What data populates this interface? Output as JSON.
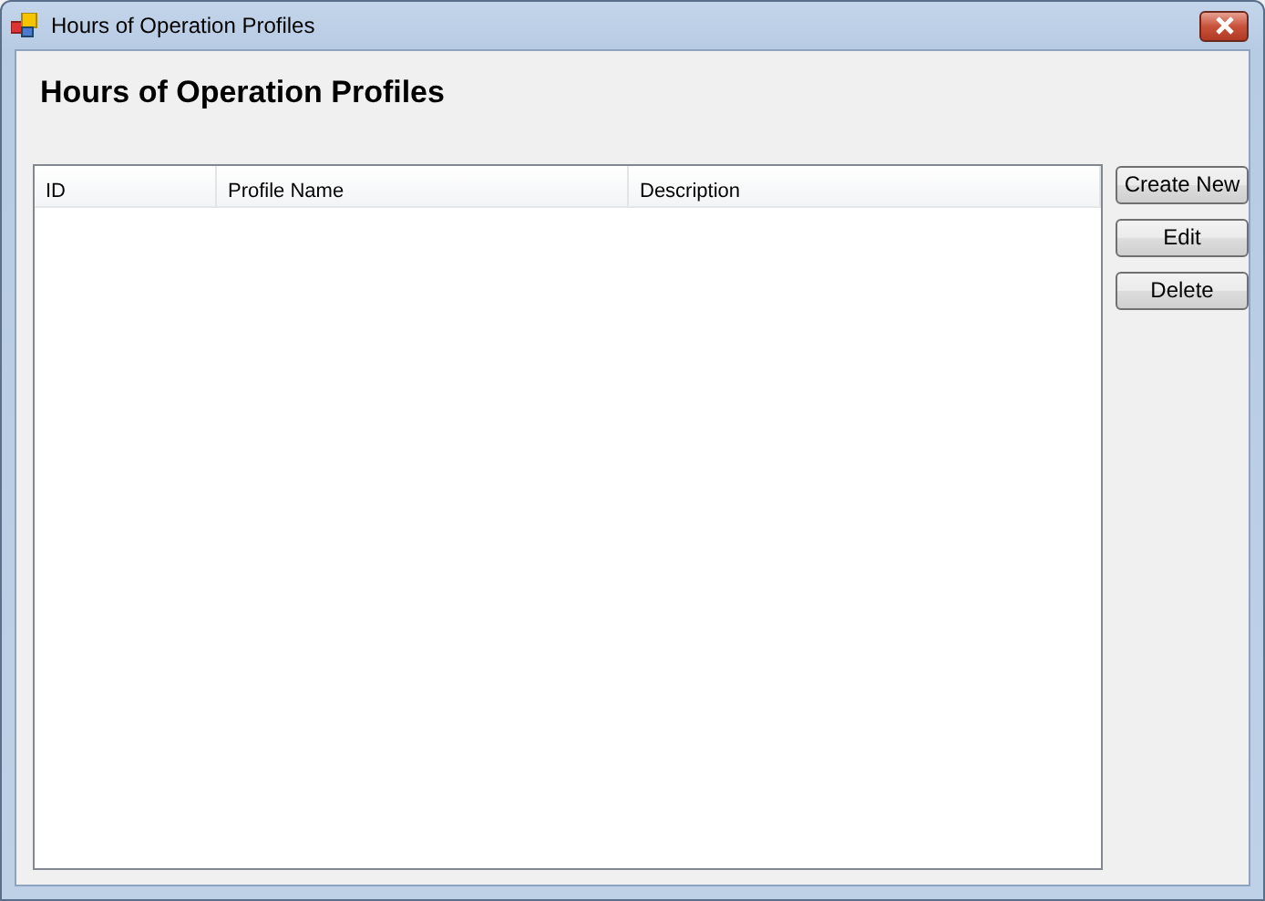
{
  "window": {
    "title": "Hours of Operation Profiles"
  },
  "heading": "Hours of Operation Profiles",
  "table": {
    "columns": [
      "ID",
      "Profile Name",
      "Description"
    ]
  },
  "buttons": [
    "Create New",
    "Edit",
    "Delete"
  ]
}
